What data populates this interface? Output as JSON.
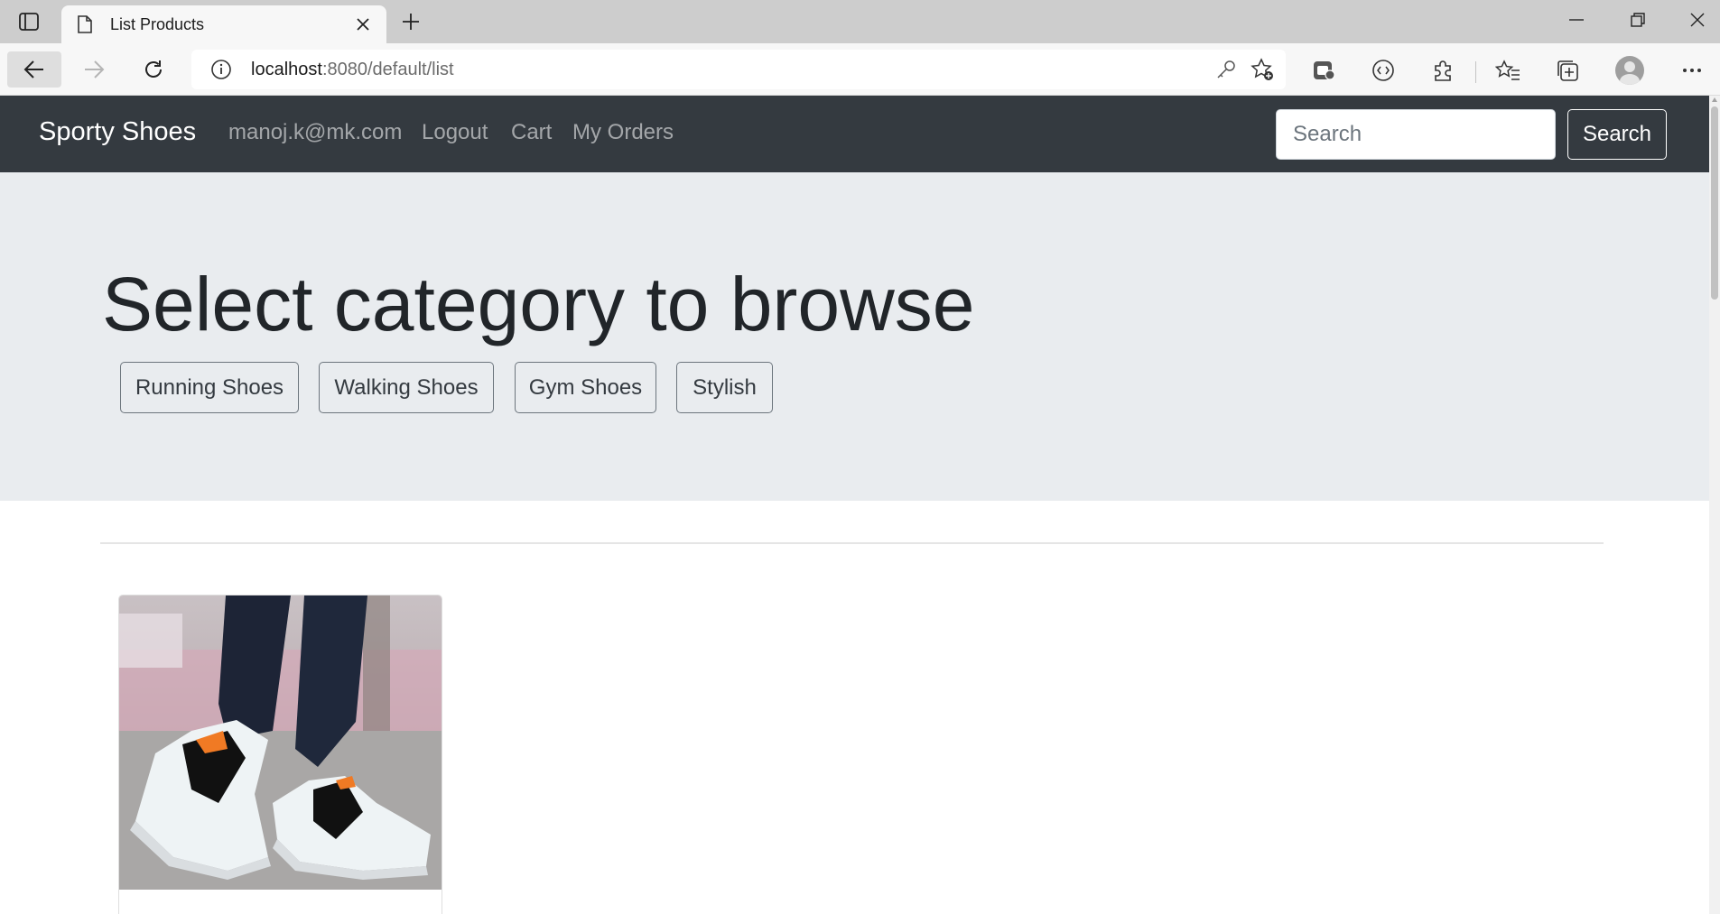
{
  "browser": {
    "tab_title": "List Products",
    "url_host": "localhost",
    "url_path": ":8080/default/list"
  },
  "navbar": {
    "brand": "Sporty Shoes",
    "links": [
      "manoj.k@mk.com",
      "Logout",
      "Cart",
      "My Orders"
    ],
    "search_placeholder": "Search",
    "search_button": "Search"
  },
  "jumbotron": {
    "heading": "Select category to browse",
    "categories": [
      "Running Shoes",
      "Walking Shoes",
      "Gym Shoes",
      "Stylish"
    ]
  },
  "products": [
    {
      "image": "black-white-sneakers-photo"
    }
  ],
  "colors": {
    "navbar_bg": "#343a40",
    "jumbotron_bg": "#e9ecef",
    "outline_button_border": "#6c757d"
  }
}
